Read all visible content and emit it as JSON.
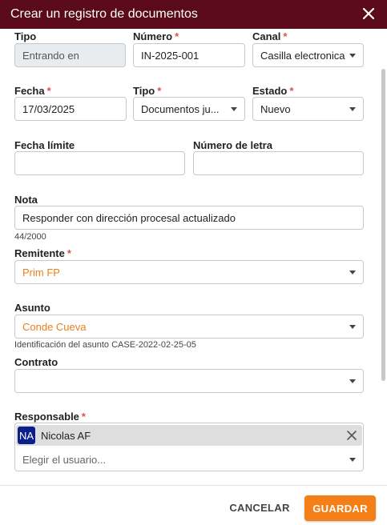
{
  "dialog": {
    "title": "Crear un registro de documentos"
  },
  "form": {
    "tipo_dir": {
      "label": "Tipo",
      "value": "Entrando en"
    },
    "numero": {
      "label": "Número",
      "required": "*",
      "value": "IN-2025-001"
    },
    "canal": {
      "label": "Canal",
      "required": "*",
      "value": "Casilla electronica"
    },
    "fecha": {
      "label": "Fecha",
      "required": "*",
      "value": "17/03/2025"
    },
    "tipo_doc": {
      "label": "Tipo",
      "required": "*",
      "value": "Documentos ju..."
    },
    "estado": {
      "label": "Estado",
      "required": "*",
      "value": "Nuevo"
    },
    "fecha_limite": {
      "label": "Fecha límite",
      "value": ""
    },
    "numero_letra": {
      "label": "Número de letra",
      "value": ""
    },
    "nota": {
      "label": "Nota",
      "value": "Responder con dirección procesal actualizado",
      "counter": "44/2000"
    },
    "remitente": {
      "label": "Remitente",
      "required": "*",
      "value": "Prim FP"
    },
    "asunto": {
      "label": "Asunto",
      "value": "Conde Cueva",
      "hint": "Identificación del asunto CASE-2022-02-25-05"
    },
    "contrato": {
      "label": "Contrato",
      "value": ""
    },
    "responsable": {
      "label": "Responsable",
      "required": "*",
      "chip_initials": "NA",
      "chip_name": "Nicolas AF",
      "placeholder": "Elegir el usuario..."
    }
  },
  "footer": {
    "cancel_label": "CANCELAR",
    "save_label": "GUARDAR"
  },
  "colors": {
    "titlebar": "#5a0a1a",
    "accent": "#f57f17",
    "required": "#d9534f",
    "link_value": "#e8801a",
    "avatar": "#0b1f8c"
  },
  "icons": {
    "close": "close-icon",
    "dropdown": "caret-down-icon",
    "chip_remove": "remove-chip-icon"
  }
}
